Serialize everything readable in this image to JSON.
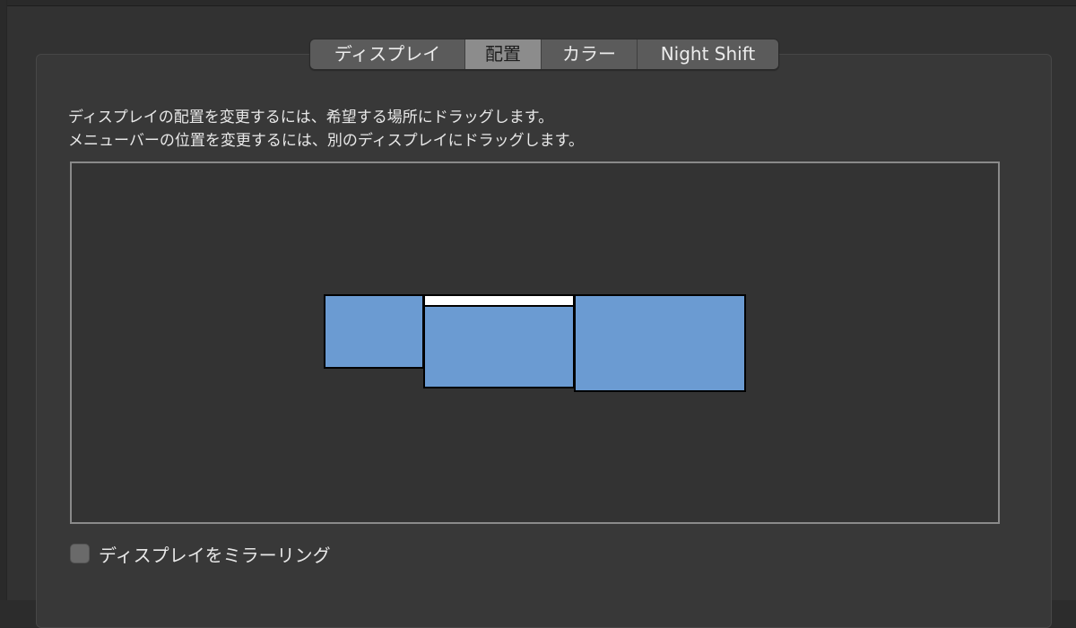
{
  "tabs": {
    "display": "ディスプレイ",
    "arrangement": "配置",
    "color": "カラー",
    "night_shift": "Night Shift",
    "selected": "配置"
  },
  "instructions": {
    "line1": "ディスプレイの配置を変更するには、希望する場所にドラッグします。",
    "line2": "メニューバーの位置を変更するには、別のディスプレイにドラッグします。"
  },
  "displays": [
    {
      "name": "left-display",
      "has_menubar": false
    },
    {
      "name": "main-display",
      "has_menubar": true
    },
    {
      "name": "right-display",
      "has_menubar": false
    }
  ],
  "mirror": {
    "label": "ディスプレイをミラーリング",
    "checked": false
  },
  "colors": {
    "display_fill": "#6b9bd2",
    "menubar": "#ffffff",
    "background": "#323232"
  }
}
